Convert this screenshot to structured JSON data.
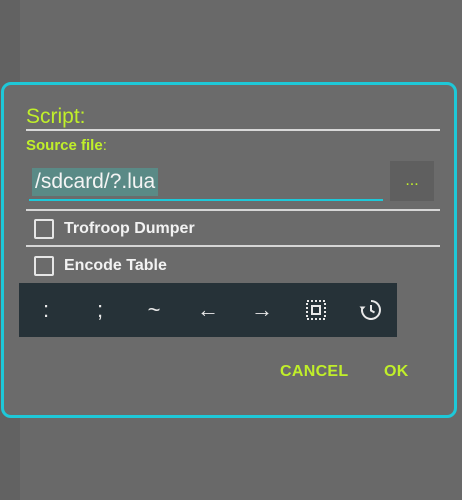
{
  "dialog": {
    "title": "Script:",
    "source_label": "Source file",
    "source_colon": ":",
    "path_value": "/sdcard/?.lua",
    "browse_label": "...",
    "options": [
      {
        "label": "Trofroop Dumper",
        "checked": false
      },
      {
        "label": "Encode Table",
        "checked": false
      }
    ],
    "keys": [
      {
        "label": ":",
        "icon": "colon-key"
      },
      {
        "label": ";",
        "icon": "semicolon-key"
      },
      {
        "label": "~",
        "icon": "tilde-key"
      },
      {
        "label": "←",
        "icon": "arrow-left-icon"
      },
      {
        "label": "→",
        "icon": "arrow-right-icon"
      },
      {
        "label": "",
        "icon": "select-all-icon"
      },
      {
        "label": "",
        "icon": "history-icon"
      }
    ],
    "cancel_label": "CANCEL",
    "ok_label": "OK"
  },
  "colors": {
    "accent": "#c0ef2a",
    "border": "#1ec8d8",
    "background": "#6b6b6b",
    "keybar": "#263238"
  }
}
